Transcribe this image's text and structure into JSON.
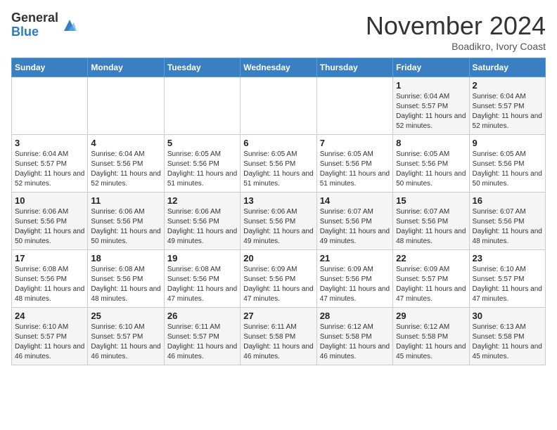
{
  "header": {
    "logo_general": "General",
    "logo_blue": "Blue",
    "month_title": "November 2024",
    "location": "Boadikro, Ivory Coast"
  },
  "calendar": {
    "days_of_week": [
      "Sunday",
      "Monday",
      "Tuesday",
      "Wednesday",
      "Thursday",
      "Friday",
      "Saturday"
    ],
    "weeks": [
      [
        {
          "day": "",
          "info": ""
        },
        {
          "day": "",
          "info": ""
        },
        {
          "day": "",
          "info": ""
        },
        {
          "day": "",
          "info": ""
        },
        {
          "day": "",
          "info": ""
        },
        {
          "day": "1",
          "info": "Sunrise: 6:04 AM\nSunset: 5:57 PM\nDaylight: 11 hours and 52 minutes."
        },
        {
          "day": "2",
          "info": "Sunrise: 6:04 AM\nSunset: 5:57 PM\nDaylight: 11 hours and 52 minutes."
        }
      ],
      [
        {
          "day": "3",
          "info": "Sunrise: 6:04 AM\nSunset: 5:57 PM\nDaylight: 11 hours and 52 minutes."
        },
        {
          "day": "4",
          "info": "Sunrise: 6:04 AM\nSunset: 5:56 PM\nDaylight: 11 hours and 52 minutes."
        },
        {
          "day": "5",
          "info": "Sunrise: 6:05 AM\nSunset: 5:56 PM\nDaylight: 11 hours and 51 minutes."
        },
        {
          "day": "6",
          "info": "Sunrise: 6:05 AM\nSunset: 5:56 PM\nDaylight: 11 hours and 51 minutes."
        },
        {
          "day": "7",
          "info": "Sunrise: 6:05 AM\nSunset: 5:56 PM\nDaylight: 11 hours and 51 minutes."
        },
        {
          "day": "8",
          "info": "Sunrise: 6:05 AM\nSunset: 5:56 PM\nDaylight: 11 hours and 50 minutes."
        },
        {
          "day": "9",
          "info": "Sunrise: 6:05 AM\nSunset: 5:56 PM\nDaylight: 11 hours and 50 minutes."
        }
      ],
      [
        {
          "day": "10",
          "info": "Sunrise: 6:06 AM\nSunset: 5:56 PM\nDaylight: 11 hours and 50 minutes."
        },
        {
          "day": "11",
          "info": "Sunrise: 6:06 AM\nSunset: 5:56 PM\nDaylight: 11 hours and 50 minutes."
        },
        {
          "day": "12",
          "info": "Sunrise: 6:06 AM\nSunset: 5:56 PM\nDaylight: 11 hours and 49 minutes."
        },
        {
          "day": "13",
          "info": "Sunrise: 6:06 AM\nSunset: 5:56 PM\nDaylight: 11 hours and 49 minutes."
        },
        {
          "day": "14",
          "info": "Sunrise: 6:07 AM\nSunset: 5:56 PM\nDaylight: 11 hours and 49 minutes."
        },
        {
          "day": "15",
          "info": "Sunrise: 6:07 AM\nSunset: 5:56 PM\nDaylight: 11 hours and 48 minutes."
        },
        {
          "day": "16",
          "info": "Sunrise: 6:07 AM\nSunset: 5:56 PM\nDaylight: 11 hours and 48 minutes."
        }
      ],
      [
        {
          "day": "17",
          "info": "Sunrise: 6:08 AM\nSunset: 5:56 PM\nDaylight: 11 hours and 48 minutes."
        },
        {
          "day": "18",
          "info": "Sunrise: 6:08 AM\nSunset: 5:56 PM\nDaylight: 11 hours and 48 minutes."
        },
        {
          "day": "19",
          "info": "Sunrise: 6:08 AM\nSunset: 5:56 PM\nDaylight: 11 hours and 47 minutes."
        },
        {
          "day": "20",
          "info": "Sunrise: 6:09 AM\nSunset: 5:56 PM\nDaylight: 11 hours and 47 minutes."
        },
        {
          "day": "21",
          "info": "Sunrise: 6:09 AM\nSunset: 5:56 PM\nDaylight: 11 hours and 47 minutes."
        },
        {
          "day": "22",
          "info": "Sunrise: 6:09 AM\nSunset: 5:57 PM\nDaylight: 11 hours and 47 minutes."
        },
        {
          "day": "23",
          "info": "Sunrise: 6:10 AM\nSunset: 5:57 PM\nDaylight: 11 hours and 47 minutes."
        }
      ],
      [
        {
          "day": "24",
          "info": "Sunrise: 6:10 AM\nSunset: 5:57 PM\nDaylight: 11 hours and 46 minutes."
        },
        {
          "day": "25",
          "info": "Sunrise: 6:10 AM\nSunset: 5:57 PM\nDaylight: 11 hours and 46 minutes."
        },
        {
          "day": "26",
          "info": "Sunrise: 6:11 AM\nSunset: 5:57 PM\nDaylight: 11 hours and 46 minutes."
        },
        {
          "day": "27",
          "info": "Sunrise: 6:11 AM\nSunset: 5:58 PM\nDaylight: 11 hours and 46 minutes."
        },
        {
          "day": "28",
          "info": "Sunrise: 6:12 AM\nSunset: 5:58 PM\nDaylight: 11 hours and 46 minutes."
        },
        {
          "day": "29",
          "info": "Sunrise: 6:12 AM\nSunset: 5:58 PM\nDaylight: 11 hours and 45 minutes."
        },
        {
          "day": "30",
          "info": "Sunrise: 6:13 AM\nSunset: 5:58 PM\nDaylight: 11 hours and 45 minutes."
        }
      ]
    ]
  }
}
